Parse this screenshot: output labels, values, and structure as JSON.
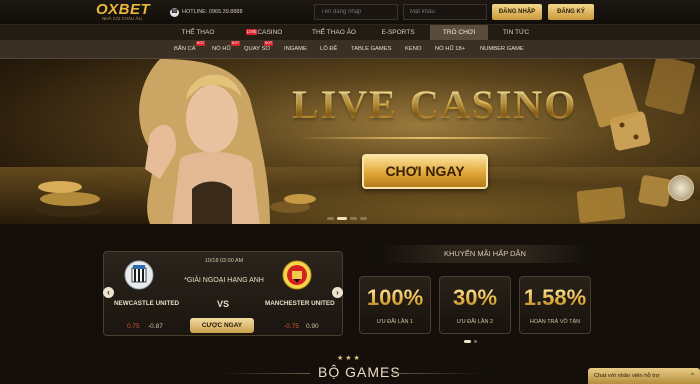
{
  "header": {
    "logo": "OXBET",
    "logo_sub": "NHÀ CÁI CHÂU ÂU",
    "hotline": "HOTLINE: 0965.39.8888",
    "username_placeholder": "Tên đăng nhập",
    "password_placeholder": "Mật khẩu",
    "login_label": "ĐĂNG NHẬP",
    "register_label": "ĐĂNG KÝ"
  },
  "nav": {
    "items": [
      "THỂ THAO",
      "CASINO",
      "THỂ THAO ẢO",
      "E-SPORTS",
      "TRÒ CHƠI",
      "TIN TỨC"
    ],
    "live_tag": "LIVE",
    "active": "TRÒ CHƠI"
  },
  "subnav": {
    "items": [
      "BẮN CÁ",
      "NỔ HŨ",
      "QUAY SỐ",
      "INGAME",
      "LÔ ĐỀ",
      "TABLE GAMES",
      "KENO",
      "NỔ HŨ 18+",
      "NUMBER GAME"
    ],
    "hot_label": "HOT"
  },
  "banner": {
    "title": "LIVE CASINO",
    "cta": "CHƠI NGAY",
    "slide_count": 4,
    "active_slide": 2
  },
  "match": {
    "time": "10/18 02:00 AM",
    "league": "*GIẢI NGOẠI HẠNG ANH",
    "home_team": "NEWCASTLE UNITED",
    "away_team": "MANCHESTER UNITED",
    "vs": "VS",
    "home_odds": [
      "0.75",
      "-0.87"
    ],
    "away_odds": [
      "-0.75",
      "0.90"
    ],
    "bet_label": "CƯỢC NGAY",
    "prev_icon": "‹",
    "next_icon": "›"
  },
  "promos": {
    "title": "KHUYẾN MÃI HẤP DẪN",
    "items": [
      {
        "value": "100%",
        "label": "ƯU ĐÃI LẦN 1"
      },
      {
        "value": "30%",
        "label": "ƯU ĐÃI LẦN 2"
      },
      {
        "value": "1.58%",
        "label": "HOÀN TRẢ VÔ TẬN"
      }
    ]
  },
  "games": {
    "stars": "★★★",
    "title": "BỘ GAMES"
  },
  "chat": {
    "label": "Chat với nhân viên hỗ trợ",
    "caret": "^"
  },
  "colors": {
    "gold": "#e8b63a",
    "dark_bg": "#140f0a",
    "live_red": "#d8272b",
    "odds_red": "#e0553a"
  }
}
